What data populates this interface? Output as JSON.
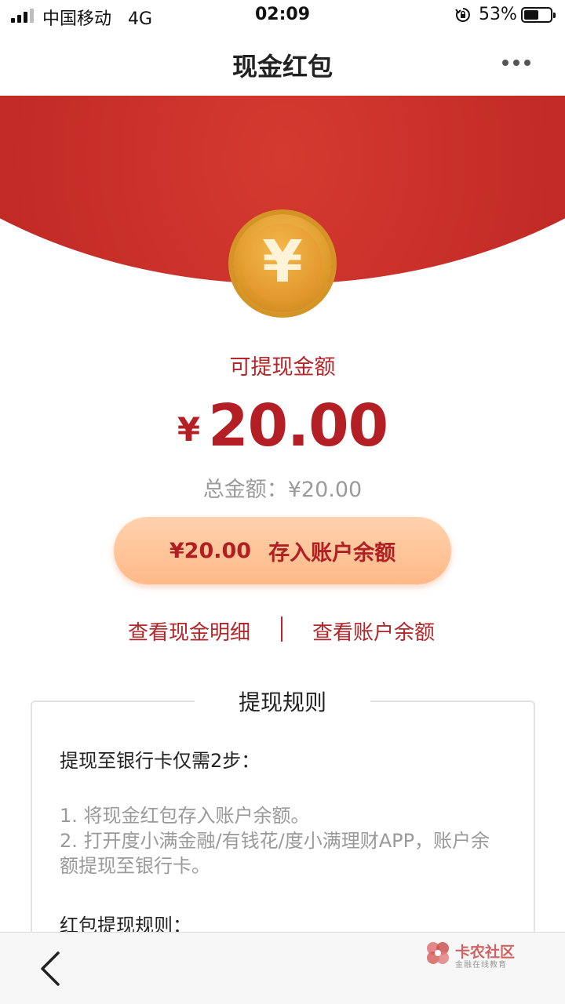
{
  "status_bar": {
    "carrier": "中国移动",
    "network": "4G",
    "time": "02:09",
    "battery": "53%"
  },
  "nav": {
    "title": "现金红包"
  },
  "coin": {
    "glyph": "¥"
  },
  "amount": {
    "label": "可提现金额",
    "currency": "¥",
    "value": "20.00",
    "total": "总金额：¥20.00"
  },
  "deposit_button": {
    "amount": "¥20.00",
    "label": "存入账户余额"
  },
  "links": {
    "cash_detail": "查看现金明细",
    "account_balance": "查看账户余额"
  },
  "rules": {
    "title": "提现规则",
    "heading1": "提现至银行卡仅需2步：",
    "step1": "1. 将现金红包存入账户余额。",
    "step2": "2. 打开度小满金融/有钱花/度小满理财APP，账户余额提现至银行卡。",
    "heading2": "红包提现规则："
  },
  "watermark": {
    "title": "卡农社区",
    "subtitle": "金融在线教育"
  },
  "colors": {
    "brand_red": "#b41f25",
    "envelope_red": "#c22a26",
    "button_peach": "#ffc49a",
    "coin_gold": "#e3982f"
  },
  "icons": {
    "more": "more-icon",
    "back": "back-icon",
    "rotation_lock": "rotation-lock-icon"
  }
}
